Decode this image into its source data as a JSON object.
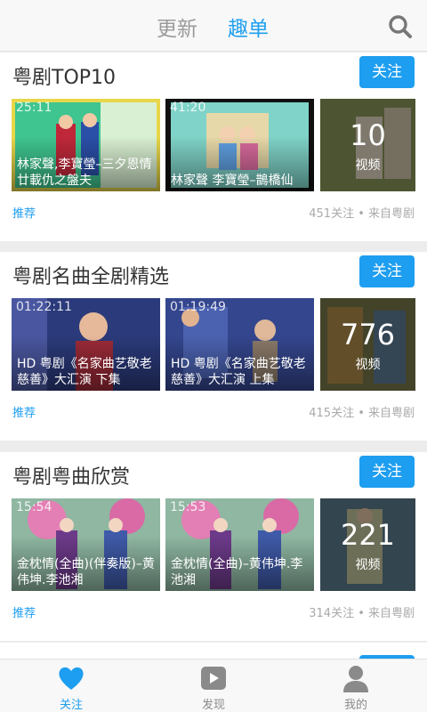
{
  "header": {
    "tabs": [
      {
        "label": "更新"
      },
      {
        "label": "趣单"
      }
    ]
  },
  "sections": [
    {
      "title": "粤剧TOP10",
      "follow_label": "关注",
      "videos": [
        {
          "duration": "25:11",
          "caption": "林家聲,李寶瑩–三夕恩情廿載仇之盤夫"
        },
        {
          "duration": "41:20",
          "caption": "林家聲 李寶瑩–鵲橋仙"
        }
      ],
      "video_count": "10",
      "video_count_label": "视频",
      "tag": "推荐",
      "meta": "451关注 • 来自粤剧"
    },
    {
      "title": "粤剧名曲全剧精选",
      "follow_label": "关注",
      "videos": [
        {
          "duration": "01:22:11",
          "caption": "HD 粤剧《名家曲艺敬老慈善》大汇演 下集"
        },
        {
          "duration": "01:19:49",
          "caption": "HD 粤剧《名家曲艺敬老慈善》大汇演 上集"
        }
      ],
      "video_count": "776",
      "video_count_label": "视频",
      "tag": "推荐",
      "meta": "415关注 • 来自粤剧"
    },
    {
      "title": "粤剧粤曲欣赏",
      "follow_label": "关注",
      "videos": [
        {
          "duration": "15:54",
          "caption": "金枕情(全曲)(伴奏版)–黄伟坤.李池湘"
        },
        {
          "duration": "15:53",
          "caption": "金枕情(全曲)–黄伟坤.李池湘"
        }
      ],
      "video_count": "221",
      "video_count_label": "视频",
      "tag": "推荐",
      "meta": "314关注 • 来自粤剧"
    }
  ],
  "bottom_nav": [
    {
      "label": "关注",
      "icon": "heart-icon"
    },
    {
      "label": "发现",
      "icon": "play-icon"
    },
    {
      "label": "我的",
      "icon": "person-icon"
    }
  ],
  "colors": {
    "accent": "#1e9ef0"
  }
}
